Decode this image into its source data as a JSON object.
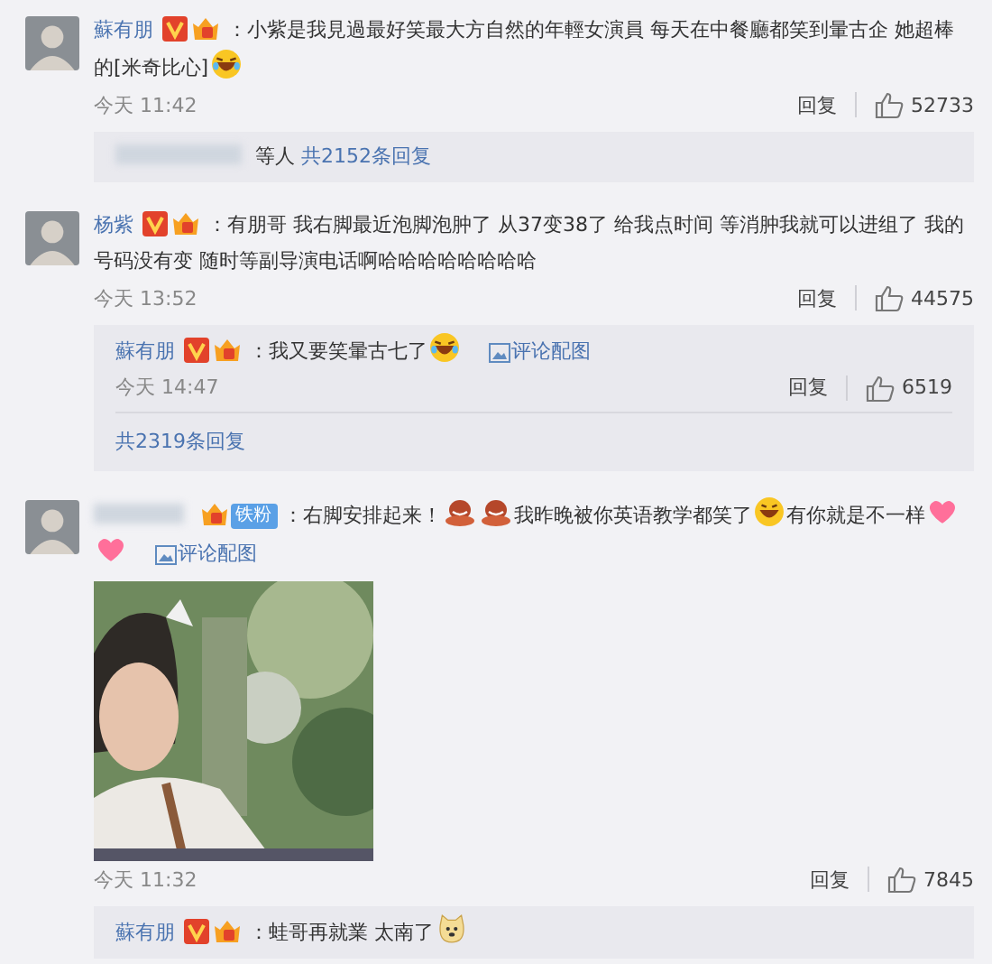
{
  "comments": [
    {
      "author": "蘇有朋",
      "badges": [
        {
          "kind": "verified"
        },
        {
          "kind": "medal"
        }
      ],
      "lines": [
        [
          {
            "kind": "text",
            "text": "：小紫是我見過最好笑最大方自然的年輕女演員 每天在中餐廳都笑到暈古企 她超棒"
          }
        ],
        [
          {
            "kind": "text",
            "text": "的[米奇比心]"
          },
          {
            "kind": "laugh"
          }
        ]
      ],
      "time": "今天 11:42",
      "reply": "回复",
      "likes": "52733",
      "thread": {
        "names_hidden": true,
        "others": "等人",
        "more": "共2152条回复"
      }
    },
    {
      "author": "杨紫",
      "badges": [
        {
          "kind": "verified"
        },
        {
          "kind": "medal"
        }
      ],
      "lines": [
        [
          {
            "kind": "text",
            "text": "：有朋哥 我右脚最近泡脚泡肿了 从37变38了 给我点时间 等消肿我就可以进组了 我的"
          }
        ],
        [
          {
            "kind": "text",
            "text": "号码没有变 随时等副导演电话啊哈哈哈哈哈哈哈哈"
          }
        ]
      ],
      "time": "今天 13:52",
      "reply": "回复",
      "likes": "44575",
      "thread": {
        "replies": [
          {
            "author": "蘇有朋",
            "badges": [
              {
                "kind": "verified"
              },
              {
                "kind": "medal"
              }
            ],
            "lines": [
              [
                {
                  "kind": "text",
                  "text": "：我又要笑暈古七了"
                },
                {
                  "kind": "laugh"
                }
              ]
            ],
            "image_link": "评论配图",
            "time": "今天 14:47",
            "reply": "回复",
            "likes": "6519"
          }
        ],
        "more": "共2319条回复"
      }
    },
    {
      "author_hidden": true,
      "badges": [
        {
          "kind": "medal"
        },
        {
          "kind": "fan",
          "label": "铁粉"
        }
      ],
      "lines": [
        [
          {
            "kind": "text",
            "text": "：右脚安排起来！"
          },
          {
            "kind": "figure"
          },
          {
            "kind": "figure"
          },
          {
            "kind": "text",
            "text": "我昨晚被你英语教学都笑了"
          },
          {
            "kind": "grin"
          },
          {
            "kind": "text",
            "text": "有你就是不一样"
          },
          {
            "kind": "heart"
          }
        ],
        [
          {
            "kind": "heart"
          }
        ]
      ],
      "image_link": "评论配图",
      "picture": {
        "kind": "picture"
      },
      "time": "今天 11:32",
      "reply": "回复",
      "likes": "7845",
      "thread": {
        "replies": [
          {
            "author": "蘇有朋",
            "badges": [
              {
                "kind": "verified"
              },
              {
                "kind": "medal"
              }
            ],
            "lines": [
              [
                {
                  "kind": "text",
                  "text": "：蛙哥再就業 太南了"
                },
                {
                  "kind": "doge"
                }
              ]
            ]
          }
        ]
      }
    }
  ]
}
